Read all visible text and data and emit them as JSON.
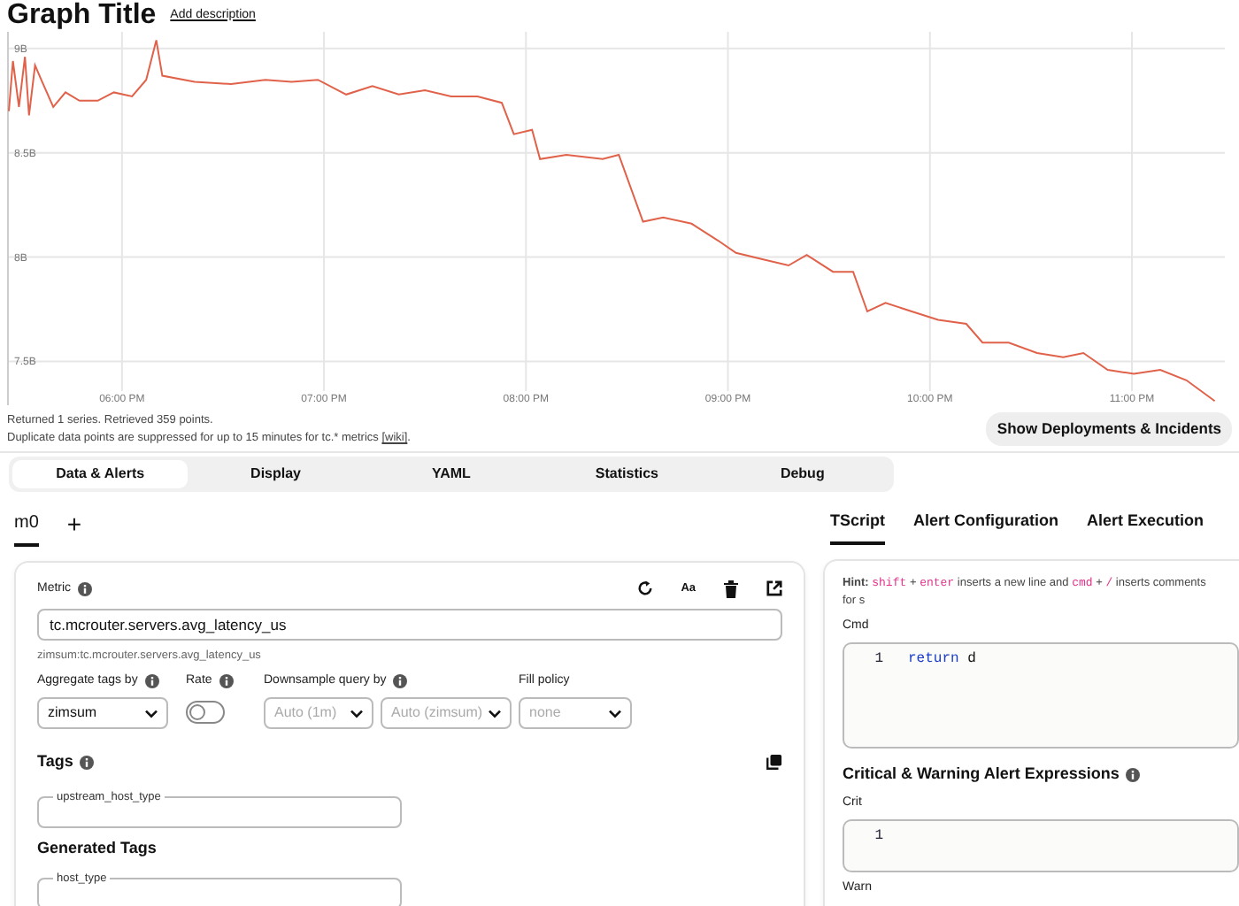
{
  "header": {
    "title": "Graph Title",
    "link": "Add description"
  },
  "chart": {
    "chart_data": {
      "type": "line",
      "grid": true,
      "x": [
        17.44,
        17.46,
        17.49,
        17.52,
        17.54,
        17.57,
        17.6,
        17.66,
        17.72,
        17.79,
        17.88,
        17.96,
        18.05,
        18.12,
        18.17,
        18.2,
        18.36,
        18.54,
        18.71,
        18.84,
        18.97,
        19.11,
        19.24,
        19.37,
        19.5,
        19.63,
        19.76,
        19.88,
        19.94,
        20.03,
        20.07,
        20.2,
        20.38,
        20.46,
        20.58,
        20.68,
        20.82,
        20.95,
        21.04,
        21.17,
        21.3,
        21.39,
        21.52,
        21.62,
        21.69,
        21.78,
        21.91,
        22.04,
        22.18,
        22.26,
        22.39,
        22.53,
        22.66,
        22.76,
        22.88,
        23.01,
        23.14,
        23.27,
        23.41
      ],
      "series": [
        {
          "color": "#e0624a",
          "values": [
            8.7,
            8.94,
            8.72,
            8.96,
            8.68,
            8.92,
            8.85,
            8.72,
            8.79,
            8.75,
            8.75,
            8.79,
            8.77,
            8.85,
            9.04,
            8.87,
            8.84,
            8.83,
            8.85,
            8.84,
            8.85,
            8.78,
            8.82,
            8.78,
            8.8,
            8.77,
            8.77,
            8.74,
            8.59,
            8.61,
            8.47,
            8.49,
            8.47,
            8.49,
            8.17,
            8.19,
            8.16,
            8.08,
            8.02,
            7.99,
            7.96,
            8.01,
            7.93,
            7.93,
            7.74,
            7.78,
            7.74,
            7.7,
            7.68,
            7.59,
            7.59,
            7.54,
            7.52,
            7.54,
            7.46,
            7.44,
            7.46,
            7.41,
            7.31
          ]
        }
      ],
      "xlim": [
        17.44,
        23.46
      ],
      "ylim": [
        7.29,
        9.08
      ],
      "xticks": [
        {
          "value": 18,
          "label": "06:00 PM"
        },
        {
          "value": 19,
          "label": "07:00 PM"
        },
        {
          "value": 20,
          "label": "08:00 PM"
        },
        {
          "value": 21,
          "label": "09:00 PM"
        },
        {
          "value": 22,
          "label": "10:00 PM"
        },
        {
          "value": 23,
          "label": "11:00 PM"
        }
      ],
      "yticks": [
        {
          "value": 9,
          "label": "9B"
        },
        {
          "value": 8.5,
          "label": "8.5B"
        },
        {
          "value": 8,
          "label": "8B"
        },
        {
          "value": 7.5,
          "label": "7.5B"
        }
      ]
    }
  },
  "info": {
    "summary": "Returned 1 series. Retrieved 359 points.",
    "note": "Duplicate data points are suppressed for up to 15 minutes for tc.* metrics",
    "note_link": "[wiki]",
    "note_end": "."
  },
  "show_button": "Show Deployments & Incidents",
  "main_tabs": [
    {
      "label": "Data & Alerts",
      "selected": true
    },
    {
      "label": "Display",
      "selected": false
    },
    {
      "label": "YAML",
      "selected": false
    },
    {
      "label": "Statistics",
      "selected": false
    },
    {
      "label": "Debug",
      "selected": false
    }
  ],
  "query_tabs": [
    {
      "label": "m0",
      "selected": true
    }
  ],
  "add_tab": "+",
  "metric_card": {
    "metric_label": "Metric",
    "font_button": "Aa",
    "metric_value": "tc.mcrouter.servers.avg_latency_us",
    "resolved": "zimsum:tc.mcrouter.servers.avg_latency_us",
    "aggregate": {
      "label": "Aggregate tags by",
      "value": "zimsum"
    },
    "rate": {
      "label": "Rate",
      "on": false
    },
    "downsample": {
      "label": "Downsample query by",
      "selects": [
        {
          "placeholder": "Auto (1m)"
        },
        {
          "placeholder": "Auto (zimsum)"
        }
      ]
    },
    "fill": {
      "label": "Fill policy",
      "placeholder": "none"
    },
    "tags_heading": "Tags",
    "tag_fields": [
      {
        "label": "upstream_host_type"
      }
    ],
    "generated_heading": "Generated Tags",
    "generated_fields": [
      {
        "label": "host_type"
      }
    ]
  },
  "script_tabs": [
    {
      "label": "TScript",
      "selected": true
    },
    {
      "label": "Alert Configuration",
      "selected": false
    },
    {
      "label": "Alert Execution",
      "selected": false
    }
  ],
  "script_card": {
    "hint": [
      {
        "kind": "label",
        "text": "Hint:"
      },
      {
        "kind": "key",
        "text": "shift"
      },
      {
        "kind": "text",
        "text": "+"
      },
      {
        "kind": "key",
        "text": "enter"
      },
      {
        "kind": "text",
        "text": "inserts a new line and"
      },
      {
        "kind": "key",
        "text": "cmd"
      },
      {
        "kind": "text",
        "text": "+"
      },
      {
        "kind": "key",
        "text": "/"
      },
      {
        "kind": "text",
        "text": "inserts comments for s"
      }
    ],
    "cmd_label": "Cmd",
    "cmd_lines": [
      {
        "number": "1",
        "tokens": [
          {
            "kind": "keyword",
            "text": "return"
          },
          {
            "kind": "plain",
            "text": "d"
          }
        ]
      }
    ],
    "expr_heading": "Critical & Warning Alert Expressions",
    "crit_label": "Crit",
    "crit_lines": [
      {
        "number": "1"
      }
    ],
    "warn_label": "Warn"
  }
}
